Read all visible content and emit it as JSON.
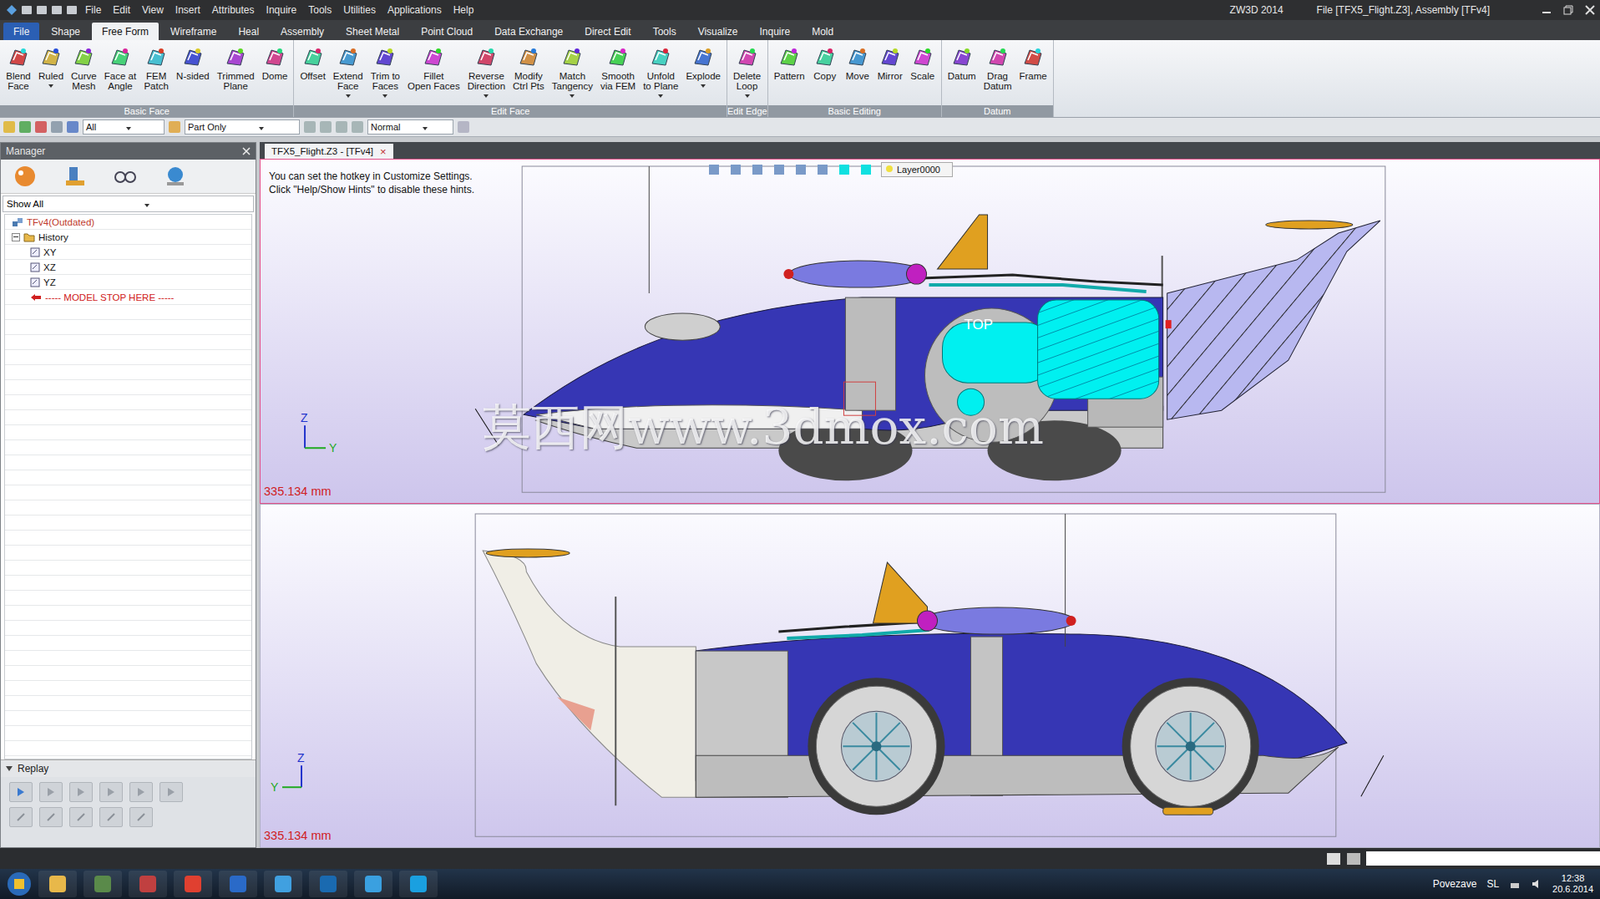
{
  "window": {
    "title": "ZW3D 2014",
    "document": "File [TFX5_Flight.Z3], Assembly [TFv4]"
  },
  "menu": [
    "File",
    "Edit",
    "View",
    "Insert",
    "Attributes",
    "Inquire",
    "Tools",
    "Utilities",
    "Applications",
    "Help"
  ],
  "ribbon_tabs": [
    {
      "label": "File",
      "selected": false,
      "kind": "app"
    },
    {
      "label": "Shape",
      "selected": false,
      "kind": "tab"
    },
    {
      "label": "Free Form",
      "selected": true,
      "kind": "tab"
    },
    {
      "label": "Wireframe",
      "selected": false,
      "kind": "tab"
    },
    {
      "label": "Heal",
      "selected": false,
      "kind": "tab"
    },
    {
      "label": "Assembly",
      "selected": false,
      "kind": "tab"
    },
    {
      "label": "Sheet Metal",
      "selected": false,
      "kind": "tab"
    },
    {
      "label": "Point Cloud",
      "selected": false,
      "kind": "tab"
    },
    {
      "label": "Data Exchange",
      "selected": false,
      "kind": "tab"
    },
    {
      "label": "Direct Edit",
      "selected": false,
      "kind": "tab"
    },
    {
      "label": "Tools",
      "selected": false,
      "kind": "tab"
    },
    {
      "label": "Visualize",
      "selected": false,
      "kind": "tab"
    },
    {
      "label": "Inquire",
      "selected": false,
      "kind": "tab"
    },
    {
      "label": "Mold",
      "selected": false,
      "kind": "tab"
    }
  ],
  "ribbon_groups": [
    {
      "title": "Basic Face",
      "buttons": [
        {
          "lines": [
            "Blend",
            "Face"
          ],
          "dropdown": false
        },
        {
          "lines": [
            "Ruled"
          ],
          "dropdown": true
        },
        {
          "lines": [
            "Curve",
            "Mesh"
          ],
          "dropdown": false
        },
        {
          "lines": [
            "Face at",
            "Angle"
          ],
          "dropdown": false
        },
        {
          "lines": [
            "FEM",
            "Patch"
          ],
          "dropdown": false
        },
        {
          "lines": [
            "N-sided"
          ],
          "dropdown": false
        },
        {
          "lines": [
            "Trimmed",
            "Plane"
          ],
          "dropdown": false
        },
        {
          "lines": [
            "Dome"
          ],
          "dropdown": false
        }
      ]
    },
    {
      "title": "Edit Face",
      "buttons": [
        {
          "lines": [
            "Offset"
          ],
          "dropdown": false
        },
        {
          "lines": [
            "Extend",
            "Face"
          ],
          "dropdown": true
        },
        {
          "lines": [
            "Trim to",
            "Faces"
          ],
          "dropdown": true
        },
        {
          "lines": [
            "Fillet",
            "Open Faces"
          ],
          "dropdown": false
        },
        {
          "lines": [
            "Reverse",
            "Direction"
          ],
          "dropdown": true
        },
        {
          "lines": [
            "Modify",
            "Ctrl Pts"
          ],
          "dropdown": false
        },
        {
          "lines": [
            "Match",
            "Tangency"
          ],
          "dropdown": true
        },
        {
          "lines": [
            "Smooth",
            "via FEM"
          ],
          "dropdown": false
        },
        {
          "lines": [
            "Unfold",
            "to Plane"
          ],
          "dropdown": true
        },
        {
          "lines": [
            "Explode"
          ],
          "dropdown": true
        }
      ]
    },
    {
      "title": "Edit Edge",
      "buttons": [
        {
          "lines": [
            "Delete",
            "Loop"
          ],
          "dropdown": true
        }
      ]
    },
    {
      "title": "Basic Editing",
      "buttons": [
        {
          "lines": [
            "Pattern"
          ],
          "dropdown": false
        },
        {
          "lines": [
            "Copy"
          ],
          "dropdown": false
        },
        {
          "lines": [
            "Move"
          ],
          "dropdown": false
        },
        {
          "lines": [
            "Mirror"
          ],
          "dropdown": false
        },
        {
          "lines": [
            "Scale"
          ],
          "dropdown": false
        }
      ]
    },
    {
      "title": "Datum",
      "buttons": [
        {
          "lines": [
            "Datum"
          ],
          "dropdown": false
        },
        {
          "lines": [
            "Drag",
            "Datum"
          ],
          "dropdown": false
        },
        {
          "lines": [
            "Frame"
          ],
          "dropdown": false
        }
      ]
    }
  ],
  "toolbar": {
    "filter": "All",
    "scope": "Part Only",
    "mode": "Normal"
  },
  "manager": {
    "title": "Manager",
    "filter": "Show All",
    "tree": [
      {
        "label": "TFv4(Outdated)",
        "kind": "root",
        "color": "#c0392b"
      },
      {
        "label": "History",
        "kind": "folder",
        "expanded": true,
        "color": "#111111"
      },
      {
        "label": "XY",
        "kind": "plane",
        "color": "#111111"
      },
      {
        "label": "XZ",
        "kind": "plane",
        "color": "#111111"
      },
      {
        "label": "YZ",
        "kind": "plane",
        "color": "#111111"
      },
      {
        "label": "----- MODEL STOP HERE -----",
        "kind": "stop",
        "color": "#d02020"
      }
    ],
    "replay": {
      "title": "Replay",
      "expanded": true
    }
  },
  "document_tab": {
    "label": "TFX5_Flight.Z3 - [TFv4]",
    "selected": true,
    "close": "×"
  },
  "viewports": [
    {
      "kind": "top",
      "active": true,
      "scale": "335.134 mm",
      "view_label": "TOP",
      "axes": [
        "Z",
        "Y"
      ],
      "hints": [
        "You can set the hotkey in Customize Settings.",
        "Click \"Help/Show Hints\" to disable these hints."
      ],
      "layer": "Layer0000"
    },
    {
      "kind": "side",
      "active": false,
      "scale": "335.134 mm",
      "view_label": "",
      "axes": [
        "Z",
        "Y"
      ],
      "hints": [],
      "layer": ""
    }
  ],
  "watermark": "莫西网www.3dmox.com",
  "taskbar": {
    "tray_text": "Povezave",
    "lang": "SL",
    "time": "12:38",
    "date": "20.6.2014"
  }
}
